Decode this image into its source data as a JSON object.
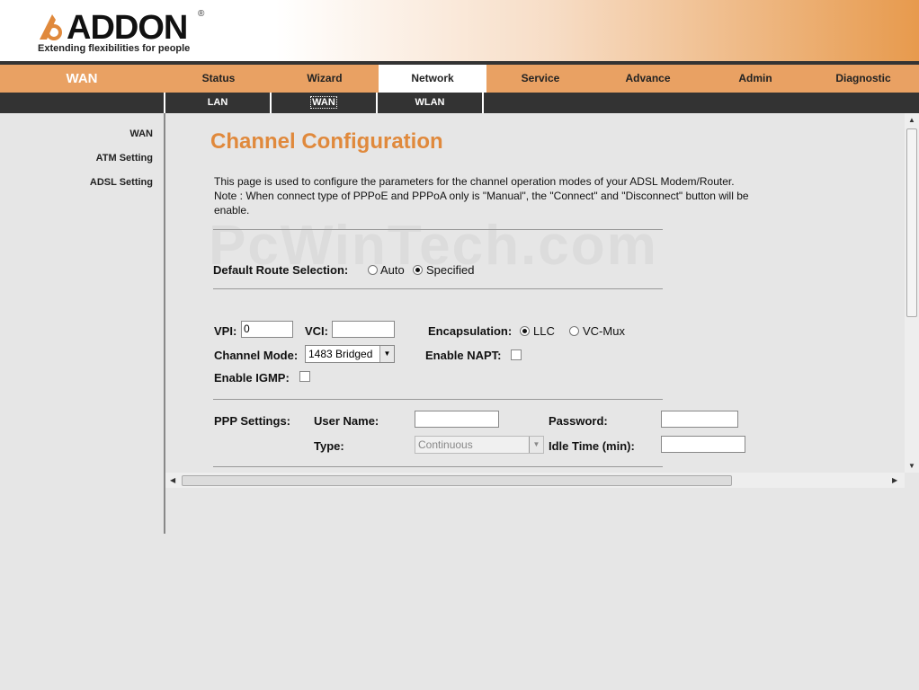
{
  "brand": {
    "name": "ADDON",
    "registered": "®",
    "tagline": "Extending flexibilities for people",
    "colors": {
      "accent": "#e0893c",
      "nav": "#e9a163",
      "subnav": "#333333"
    }
  },
  "topnav": {
    "section_title": "WAN",
    "tabs": [
      {
        "label": "Status"
      },
      {
        "label": "Wizard"
      },
      {
        "label": "Network",
        "active": true
      },
      {
        "label": "Service"
      },
      {
        "label": "Advance"
      },
      {
        "label": "Admin"
      },
      {
        "label": "Diagnostic"
      }
    ]
  },
  "subnav": {
    "tabs": [
      {
        "label": "LAN"
      },
      {
        "label": "WAN",
        "active": true
      },
      {
        "label": "WLAN"
      }
    ]
  },
  "sidebar": {
    "items": [
      {
        "label": "WAN"
      },
      {
        "label": "ATM Setting"
      },
      {
        "label": "ADSL Setting"
      }
    ]
  },
  "page": {
    "title": "Channel Configuration",
    "description": "This page is used to configure the parameters for the channel operation modes of your ADSL Modem/Router. Note : When connect type of PPPoE and PPPoA only is \"Manual\", the \"Connect\" and \"Disconnect\" button will be enable.",
    "watermark": "PcWinTech.com"
  },
  "route": {
    "label": "Default Route Selection:",
    "options": [
      {
        "label": "Auto",
        "checked": false
      },
      {
        "label": "Specified",
        "checked": true
      }
    ]
  },
  "channel": {
    "vpi_label": "VPI:",
    "vpi_value": "0",
    "vci_label": "VCI:",
    "vci_value": "",
    "encapsulation_label": "Encapsulation:",
    "encapsulation_options": [
      {
        "label": "LLC",
        "checked": true
      },
      {
        "label": "VC-Mux",
        "checked": false
      }
    ],
    "mode_label": "Channel Mode:",
    "mode_value": "1483 Bridged",
    "napt_label": "Enable NAPT:",
    "napt_checked": false,
    "igmp_label": "Enable IGMP:",
    "igmp_checked": false
  },
  "ppp": {
    "label": "PPP Settings:",
    "username_label": "User Name:",
    "username_value": "",
    "password_label": "Password:",
    "password_value": "",
    "type_label": "Type:",
    "type_value": "Continuous",
    "idle_label": "Idle Time (min):",
    "idle_value": ""
  },
  "icons": {
    "select_arrow": "chevron-down-icon",
    "scroll_up": "arrow-up-icon",
    "scroll_down": "arrow-down-icon",
    "scroll_left": "arrow-left-icon",
    "scroll_right": "arrow-right-icon"
  }
}
